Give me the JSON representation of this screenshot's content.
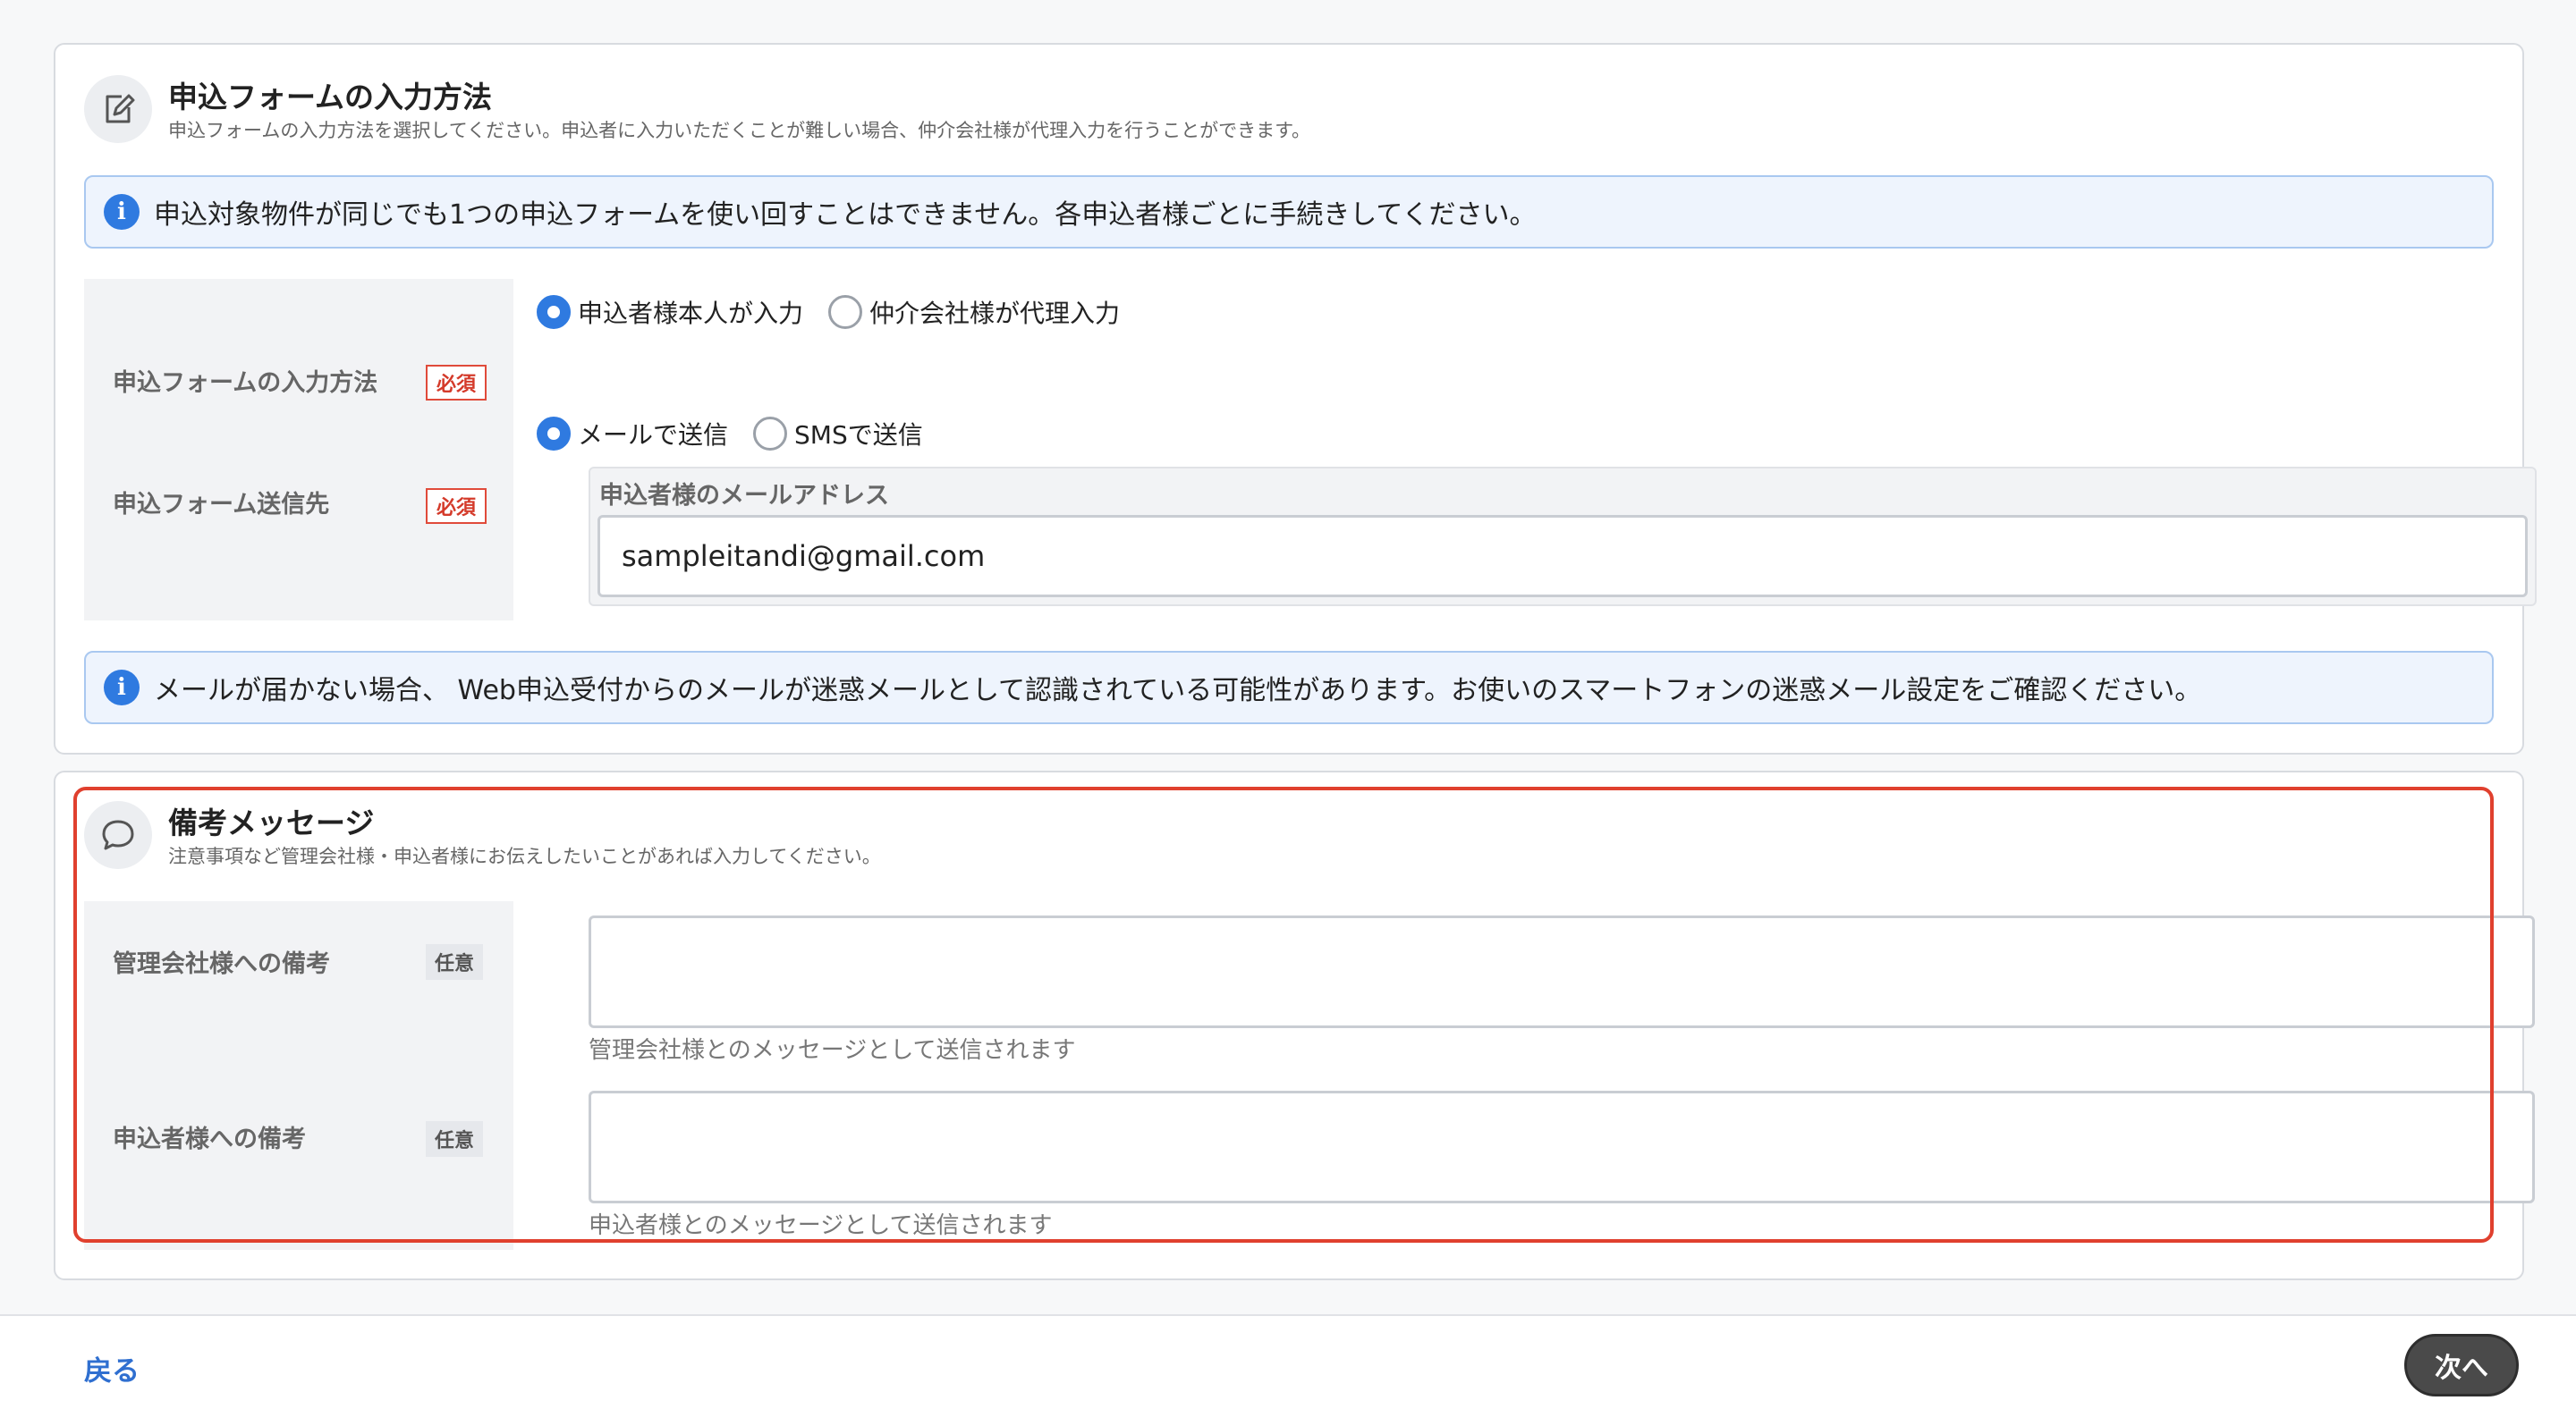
{
  "input_method_section": {
    "icon": "edit-icon",
    "title": "申込フォームの入力方法",
    "description": "申込フォームの入力方法を選択してください。申込者に入力いただくことが難しい場合、仲介会社様が代理入力を行うことができます。",
    "info_notice": "申込対象物件が同じでも1つの申込フォームを使い回すことはできません。各申込者様ごとに手続きしてください。",
    "input_method": {
      "label": "申込フォームの入力方法",
      "badge": "必須",
      "options": [
        {
          "label": "申込者様本人が入力",
          "selected": true
        },
        {
          "label": "仲介会社様が代理入力",
          "selected": false
        }
      ]
    },
    "send_to": {
      "label": "申込フォーム送信先",
      "badge": "必須",
      "options": [
        {
          "label": "メールで送信",
          "selected": true
        },
        {
          "label": "SMSで送信",
          "selected": false
        }
      ],
      "email_label": "申込者様のメールアドレス",
      "email_value": "sampleitandi@gmail.com"
    },
    "mail_notice": "メールが届かない場合、 Web申込受付からのメールが迷惑メールとして認識されている可能性があります。お使いのスマートフォンの迷惑メール設定をご確認ください。"
  },
  "remarks_section": {
    "icon": "chat-bubble-icon",
    "title": "備考メッセージ",
    "description": "注意事項など管理会社様・申込者様にお伝えしたいことがあれば入力してください。",
    "management_note": {
      "label": "管理会社様への備考",
      "badge": "任意",
      "value": "",
      "helper": "管理会社様とのメッセージとして送信されます"
    },
    "applicant_note": {
      "label": "申込者様への備考",
      "badge": "任意",
      "value": "",
      "helper": "申込者様とのメッセージとして送信されます"
    }
  },
  "footer": {
    "back_label": "戻る",
    "next_label": "次へ"
  },
  "colors": {
    "accent": "#2f7ae0",
    "required": "#e04a3a",
    "highlight": "#e0402e",
    "next_button": "#4a4a4a"
  }
}
